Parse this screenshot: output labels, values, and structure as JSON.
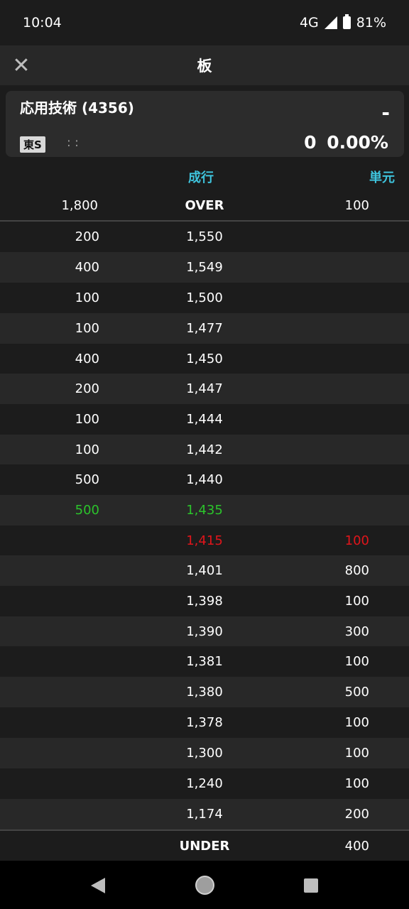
{
  "status_bar": {
    "time": "10:04",
    "network": "4G",
    "battery": "81%"
  },
  "app_bar": {
    "title": "板"
  },
  "stock": {
    "name": "応用技術 (4356)",
    "price": "-",
    "market": "東S",
    "time": ": :",
    "change": "0 0.00%"
  },
  "columns": {
    "middle": "成行",
    "right": "単元"
  },
  "over": {
    "quantity": "1,800",
    "label": "OVER",
    "unit": "100"
  },
  "under": {
    "label": "UNDER",
    "unit": "400"
  },
  "asks": [
    {
      "qty": "200",
      "price": "1,550"
    },
    {
      "qty": "400",
      "price": "1,549"
    },
    {
      "qty": "100",
      "price": "1,500"
    },
    {
      "qty": "100",
      "price": "1,477"
    },
    {
      "qty": "400",
      "price": "1,450"
    },
    {
      "qty": "200",
      "price": "1,447"
    },
    {
      "qty": "100",
      "price": "1,444"
    },
    {
      "qty": "100",
      "price": "1,442"
    },
    {
      "qty": "500",
      "price": "1,440"
    },
    {
      "qty": "500",
      "price": "1,435"
    }
  ],
  "bids": [
    {
      "price": "1,415",
      "qty": "100"
    },
    {
      "price": "1,401",
      "qty": "800"
    },
    {
      "price": "1,398",
      "qty": "100"
    },
    {
      "price": "1,390",
      "qty": "300"
    },
    {
      "price": "1,381",
      "qty": "100"
    },
    {
      "price": "1,380",
      "qty": "500"
    },
    {
      "price": "1,378",
      "qty": "100"
    },
    {
      "price": "1,300",
      "qty": "100"
    },
    {
      "price": "1,240",
      "qty": "100"
    },
    {
      "price": "1,174",
      "qty": "200"
    }
  ],
  "colors": {
    "accent": "#3ec3dc",
    "best_ask": "#2bc42b",
    "best_bid": "#e0151b"
  }
}
